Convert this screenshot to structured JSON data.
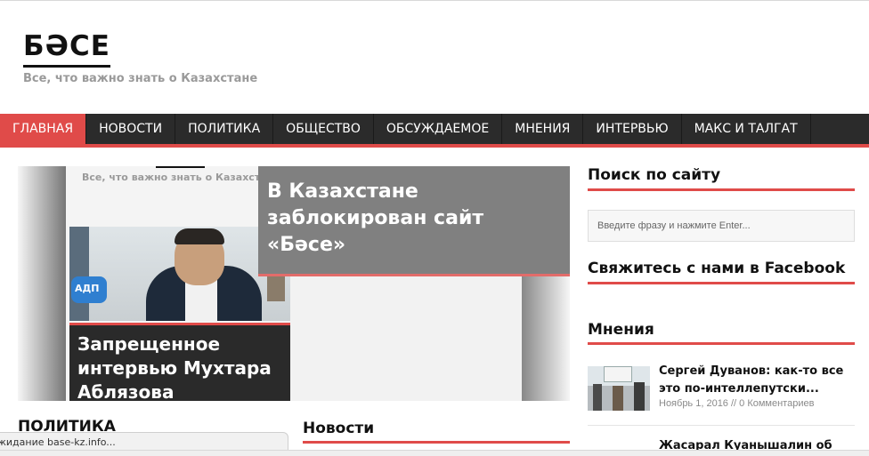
{
  "site": {
    "logo": "БӘСЕ",
    "tagline": "Все, что важно знать о Казахстане"
  },
  "nav": {
    "items": [
      {
        "label": "ГЛАВНАЯ",
        "active": true
      },
      {
        "label": "НОВОСТИ",
        "active": false
      },
      {
        "label": "ПОЛИТИКА",
        "active": false
      },
      {
        "label": "ОБЩЕСТВО",
        "active": false
      },
      {
        "label": "ОБСУЖДАЕМОЕ",
        "active": false
      },
      {
        "label": "МНЕНИЯ",
        "active": false
      },
      {
        "label": "ИНТЕРВЬЮ",
        "active": false
      },
      {
        "label": "МАКС И ТАЛГАТ",
        "active": false
      }
    ]
  },
  "slider": {
    "ghost_tagline": "Все, что важно знать о Казахстане",
    "photo_badge": "АДП",
    "left_caption": "Запрещенное интервью Мухтара Аблязова",
    "right_caption": "В Казахстане заблокирован сайт «Бәсе»"
  },
  "sections": {
    "politika": "ПОЛИТИКА",
    "novosti": "Новости"
  },
  "status_bar": "жидание base-kz.info...",
  "sidebar": {
    "search_heading": "Поиск по сайту",
    "search_placeholder": "Введите фразу и нажмите Enter...",
    "facebook_heading": "Свяжитесь с нами в Facebook",
    "opinions_heading": "Мнения",
    "opinions": [
      {
        "title": "Сергей Дуванов: как-то все это по-интеллепутски...",
        "meta": "Ноябрь 1, 2016 // 0 Комментариев"
      },
      {
        "title": "Жасарал Куанышалин об",
        "meta": ""
      }
    ]
  },
  "colors": {
    "accent": "#e04b49",
    "nav_bg": "#2b2b2b",
    "caption_grey": "#808080",
    "caption_dark": "#2a2a2a"
  }
}
